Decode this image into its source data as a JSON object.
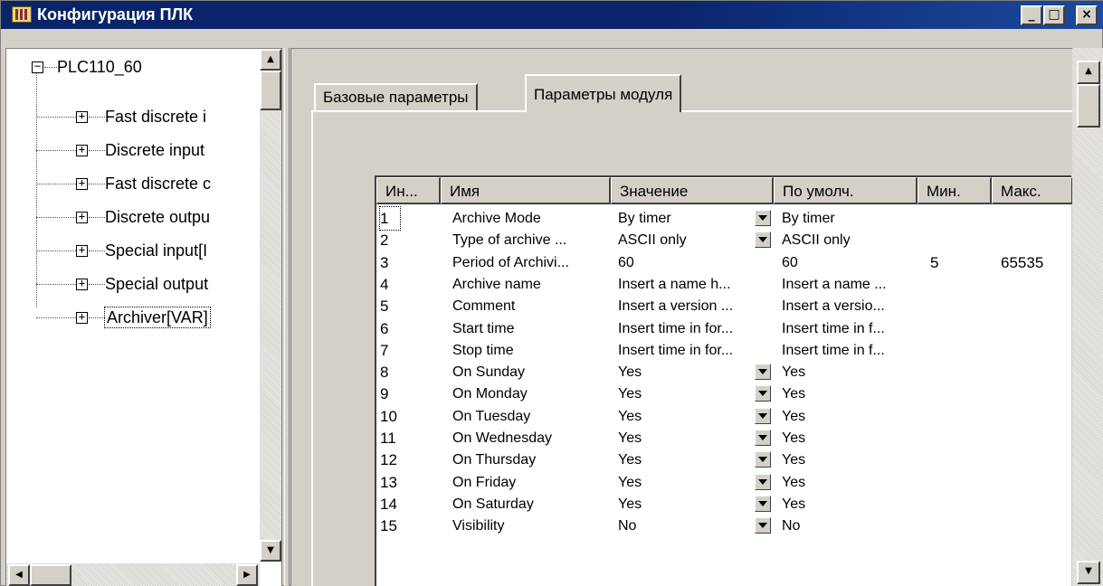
{
  "window": {
    "title": "Конфигурация ПЛК",
    "controls": {
      "minimize": "_",
      "maximize": "□",
      "close": "×"
    }
  },
  "tree": {
    "root": "PLC110_60",
    "expander_collapse": "−",
    "expander_expand": "+",
    "items": [
      "Fast discrete i",
      "Discrete input",
      "Fast discrete c",
      "Discrete outpu",
      "Special input[I",
      "Special output",
      "Archiver[VAR]"
    ]
  },
  "scroll": {
    "up": "▲",
    "down": "▼",
    "left": "◀",
    "right": "▶"
  },
  "tabs": [
    {
      "label": "Базовые параметры",
      "active": false
    },
    {
      "label": "Параметры модуля",
      "active": true
    }
  ],
  "grid": {
    "columns": [
      "Ин...",
      "Имя",
      "Значение",
      "По умолч.",
      "Мин.",
      "Макс."
    ],
    "rows": [
      {
        "idx": "1",
        "name": "Archive Mode",
        "value": "By timer",
        "dropdown": true,
        "default": "By timer",
        "min": "",
        "max": ""
      },
      {
        "idx": "2",
        "name": "Type of archive ...",
        "value": "ASCII only",
        "dropdown": true,
        "default": "ASCII only",
        "min": "",
        "max": ""
      },
      {
        "idx": "3",
        "name": "Period of Archivi...",
        "value": "60",
        "dropdown": false,
        "default": "60",
        "min": "5",
        "max": "65535"
      },
      {
        "idx": "4",
        "name": "Archive name",
        "value": "Insert a name h...",
        "dropdown": false,
        "default": "Insert a name ...",
        "min": "",
        "max": ""
      },
      {
        "idx": "5",
        "name": "Comment",
        "value": "Insert a version ...",
        "dropdown": false,
        "default": "Insert a versio...",
        "min": "",
        "max": ""
      },
      {
        "idx": "6",
        "name": "Start time",
        "value": "Insert time in for...",
        "dropdown": false,
        "default": "Insert time in f...",
        "min": "",
        "max": ""
      },
      {
        "idx": "7",
        "name": "Stop time",
        "value": "Insert time in for...",
        "dropdown": false,
        "default": "Insert time in f...",
        "min": "",
        "max": ""
      },
      {
        "idx": "8",
        "name": "On Sunday",
        "value": "Yes",
        "dropdown": true,
        "default": "Yes",
        "min": "",
        "max": ""
      },
      {
        "idx": "9",
        "name": "On Monday",
        "value": "Yes",
        "dropdown": true,
        "default": "Yes",
        "min": "",
        "max": ""
      },
      {
        "idx": "10",
        "name": "On Tuesday",
        "value": "Yes",
        "dropdown": true,
        "default": "Yes",
        "min": "",
        "max": ""
      },
      {
        "idx": "11",
        "name": "On Wednesday",
        "value": "Yes",
        "dropdown": true,
        "default": "Yes",
        "min": "",
        "max": ""
      },
      {
        "idx": "12",
        "name": "On Thursday",
        "value": "Yes",
        "dropdown": true,
        "default": "Yes",
        "min": "",
        "max": ""
      },
      {
        "idx": "13",
        "name": "On Friday",
        "value": "Yes",
        "dropdown": true,
        "default": "Yes",
        "min": "",
        "max": ""
      },
      {
        "idx": "14",
        "name": "On Saturday",
        "value": "Yes",
        "dropdown": true,
        "default": "Yes",
        "min": "",
        "max": ""
      },
      {
        "idx": "15",
        "name": "Visibility",
        "value": "No",
        "dropdown": true,
        "default": "No",
        "min": "",
        "max": ""
      }
    ]
  }
}
